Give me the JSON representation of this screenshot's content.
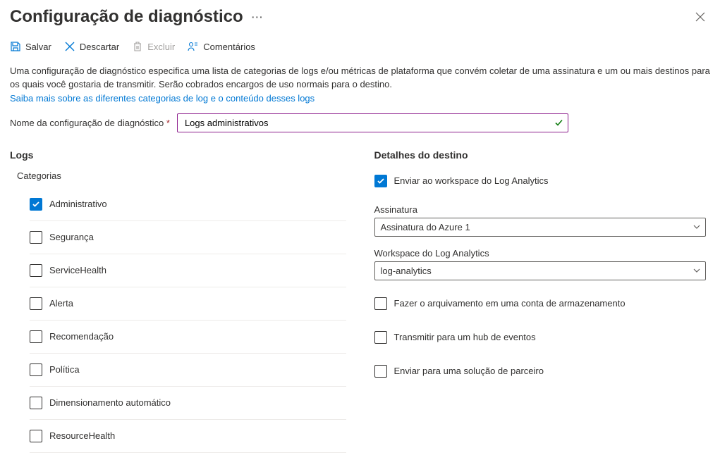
{
  "header": {
    "title": "Configuração de diagnóstico"
  },
  "toolbar": {
    "save": "Salvar",
    "discard": "Descartar",
    "delete": "Excluir",
    "feedback": "Comentários"
  },
  "description": {
    "text": "Uma configuração de diagnóstico especifica uma lista de categorias de logs e/ou métricas de plataforma que convém coletar de uma assinatura e um ou mais destinos para os quais você gostaria de transmitir. Serão cobrados encargos de uso normais para o destino.",
    "link": "Saiba mais sobre as diferentes categorias de log e o conteúdo desses logs"
  },
  "nameField": {
    "label": "Nome da configuração de diagnóstico",
    "value": "Logs administrativos"
  },
  "logs": {
    "header": "Logs",
    "categoriesLabel": "Categorias",
    "categories": [
      {
        "label": "Administrativo",
        "checked": true
      },
      {
        "label": "Segurança",
        "checked": false
      },
      {
        "label": "ServiceHealth",
        "checked": false
      },
      {
        "label": "Alerta",
        "checked": false
      },
      {
        "label": "Recomendação",
        "checked": false
      },
      {
        "label": "Política",
        "checked": false
      },
      {
        "label": "Dimensionamento automático",
        "checked": false
      },
      {
        "label": "ResourceHealth",
        "checked": false
      }
    ]
  },
  "destination": {
    "header": "Detalhes do destino",
    "logAnalytics": {
      "label": "Enviar ao workspace do Log Analytics",
      "checked": true,
      "subscriptionLabel": "Assinatura",
      "subscriptionValue": "Assinatura do Azure 1",
      "workspaceLabel": "Workspace do Log Analytics",
      "workspaceValue": "log-analytics"
    },
    "storage": {
      "label": "Fazer o arquivamento em uma conta de armazenamento",
      "checked": false
    },
    "eventHub": {
      "label": "Transmitir para um hub de eventos",
      "checked": false
    },
    "partner": {
      "label": "Enviar para uma solução de parceiro",
      "checked": false
    }
  }
}
